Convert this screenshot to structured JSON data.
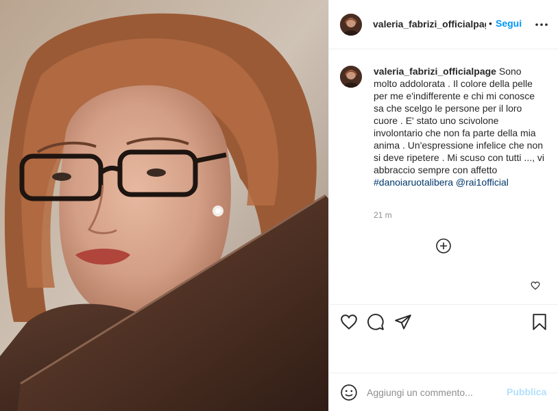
{
  "post": {
    "username": "valeria_fabrizi_officialpage",
    "separator": "•",
    "follow_label": "Segui",
    "more_icon": "more-horizontal-icon"
  },
  "caption": {
    "username": "valeria_fabrizi_officialpage",
    "text": "Sono molto addolorata . Il colore della pelle per me e'indifferente e chi mi conosce sa che scelgo le persone per il loro cuore . E' stato uno scivolone involontario che non fa parte della mia anima . Un'espressione infelice che non si deve ripetere . Mi scuso con tutti ..., vi abbraccio sempre con affetto",
    "hashtag": "#danoiaruotalibera",
    "mention": "@rai1official",
    "time": "21 m"
  },
  "icons": {
    "load_more": "plus-circle-icon",
    "comment_like": "heart-small-icon",
    "like": "heart-icon",
    "comment": "comment-icon",
    "share": "paper-plane-icon",
    "save": "bookmark-icon",
    "emoji": "smiley-icon"
  },
  "comment_box": {
    "placeholder": "Aggiungi un commento...",
    "publish_label": "Pubblica"
  },
  "colors": {
    "accent": "#0095f6",
    "publish_disabled": "#b2dffc",
    "hashtag": "#00376b",
    "muted": "#8e8e8e"
  }
}
